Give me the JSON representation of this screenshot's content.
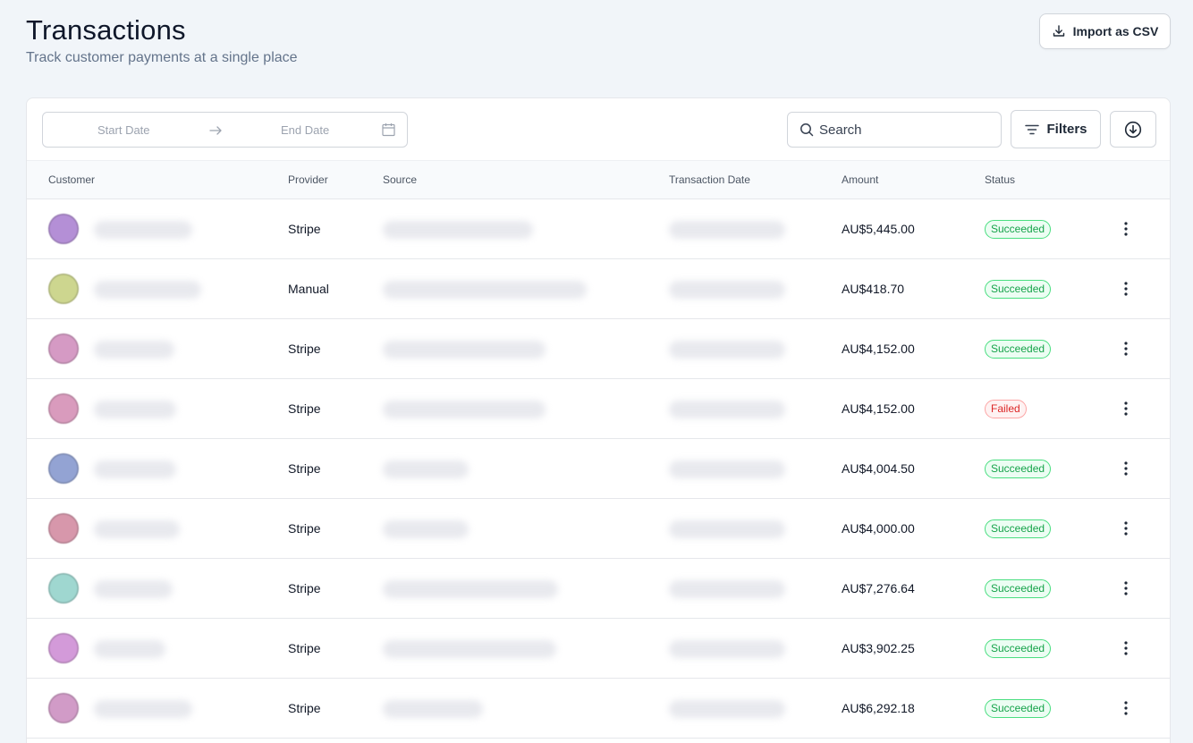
{
  "header": {
    "title": "Transactions",
    "subtitle": "Track customer payments at a single place",
    "import_label": "Import as CSV"
  },
  "toolbar": {
    "start_date_placeholder": "Start Date",
    "end_date_placeholder": "End Date",
    "search_placeholder": "Search",
    "filters_label": "Filters"
  },
  "columns": {
    "customer": "Customer",
    "provider": "Provider",
    "source": "Source",
    "date": "Transaction Date",
    "amount": "Amount",
    "status": "Status"
  },
  "colors": {
    "success": "#16a34a",
    "failed": "#dc2626"
  },
  "rows": [
    {
      "provider": "Stripe",
      "amount": "AU$5,445.00",
      "status": "Succeeded",
      "avatar_color": "#b48fd6"
    },
    {
      "provider": "Manual",
      "amount": "AU$418.70",
      "status": "Succeeded",
      "avatar_color": "#cdd68f"
    },
    {
      "provider": "Stripe",
      "amount": "AU$4,152.00",
      "status": "Succeeded",
      "avatar_color": "#d59ac4"
    },
    {
      "provider": "Stripe",
      "amount": "AU$4,152.00",
      "status": "Failed",
      "avatar_color": "#d99bbd"
    },
    {
      "provider": "Stripe",
      "amount": "AU$4,004.50",
      "status": "Succeeded",
      "avatar_color": "#93a3d3"
    },
    {
      "provider": "Stripe",
      "amount": "AU$4,000.00",
      "status": "Succeeded",
      "avatar_color": "#d797ab"
    },
    {
      "provider": "Stripe",
      "amount": "AU$7,276.64",
      "status": "Succeeded",
      "avatar_color": "#9fd7d0"
    },
    {
      "provider": "Stripe",
      "amount": "AU$3,902.25",
      "status": "Succeeded",
      "avatar_color": "#d39ad9"
    },
    {
      "provider": "Stripe",
      "amount": "AU$6,292.18",
      "status": "Succeeded",
      "avatar_color": "#d19bc7"
    }
  ]
}
